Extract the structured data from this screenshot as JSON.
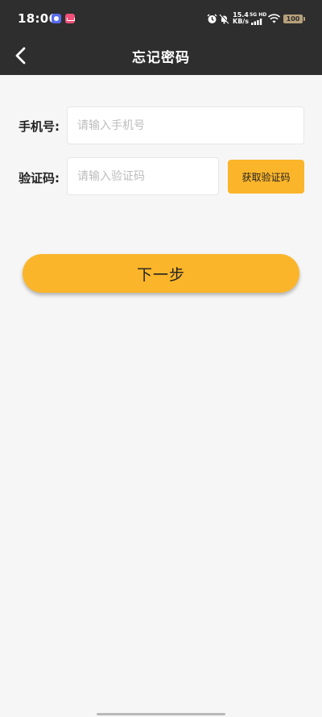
{
  "status_bar": {
    "time": "18:06",
    "net_speed_value": "15.4",
    "net_speed_unit": "KB/s",
    "net_type_top": "5G HD",
    "battery": "100",
    "icons": [
      "app-notification-icon",
      "gallery-notification-icon",
      "alarm-icon",
      "do-not-disturb-icon",
      "signal-icon",
      "wifi-icon",
      "battery-icon"
    ]
  },
  "navbar": {
    "title": "忘记密码",
    "back_icon": "chevron-left-icon"
  },
  "form": {
    "phone": {
      "label": "手机号:",
      "placeholder": "请输入手机号",
      "value": ""
    },
    "code": {
      "label": "验证码:",
      "placeholder": "请输入验证码",
      "value": "",
      "button_label": "获取验证码"
    },
    "next_label": "下一步"
  },
  "colors": {
    "header_bg": "#2e2e2e",
    "accent": "#fbb52b",
    "page_bg": "#f6f6f6"
  }
}
